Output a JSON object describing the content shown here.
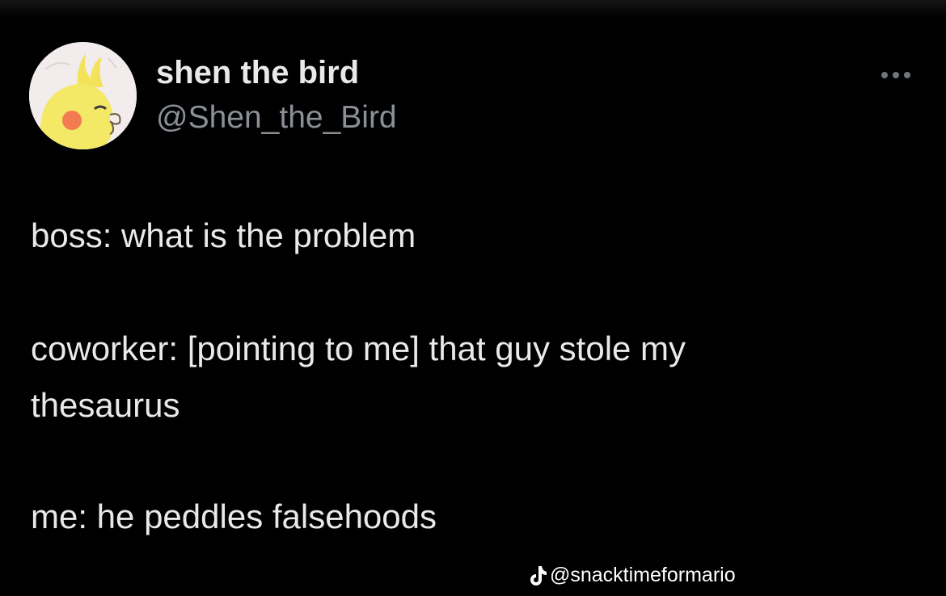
{
  "tweet": {
    "author": {
      "display_name": "shen the bird",
      "handle": "@Shen_the_Bird",
      "avatar_icon": "cockatiel-avatar"
    },
    "more_icon": "more-options-icon",
    "lines": [
      "boss: what is the problem",
      "coworker: [pointing to me] that guy stole my",
      "thesaurus",
      "me: he peddles falsehoods"
    ]
  },
  "watermark": {
    "icon": "tiktok-icon",
    "username": "@snacktimeformario"
  },
  "colors": {
    "background": "#000000",
    "text": "#e7e9ea",
    "handle": "#8b9096"
  }
}
